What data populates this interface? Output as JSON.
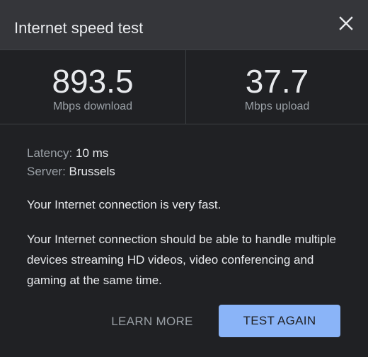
{
  "dialog": {
    "title": "Internet speed test",
    "close_icon": "close-icon"
  },
  "results": {
    "download": {
      "value": "893.5",
      "label": "Mbps download"
    },
    "upload": {
      "value": "37.7",
      "label": "Mbps upload"
    }
  },
  "details": {
    "latency_label": "Latency:",
    "latency_value": "10 ms",
    "server_label": "Server:",
    "server_value": "Brussels"
  },
  "summary": "Your Internet connection is very fast.",
  "description": "Your Internet connection should be able to handle multiple devices streaming HD videos, video conferencing and gaming at the same time.",
  "actions": {
    "learn_more": "LEARN MORE",
    "test_again": "TEST AGAIN"
  },
  "colors": {
    "background": "#202124",
    "header": "#35363a",
    "accent": "#8ab4f8",
    "text": "#e8eaed",
    "muted": "#9aa0a6"
  }
}
